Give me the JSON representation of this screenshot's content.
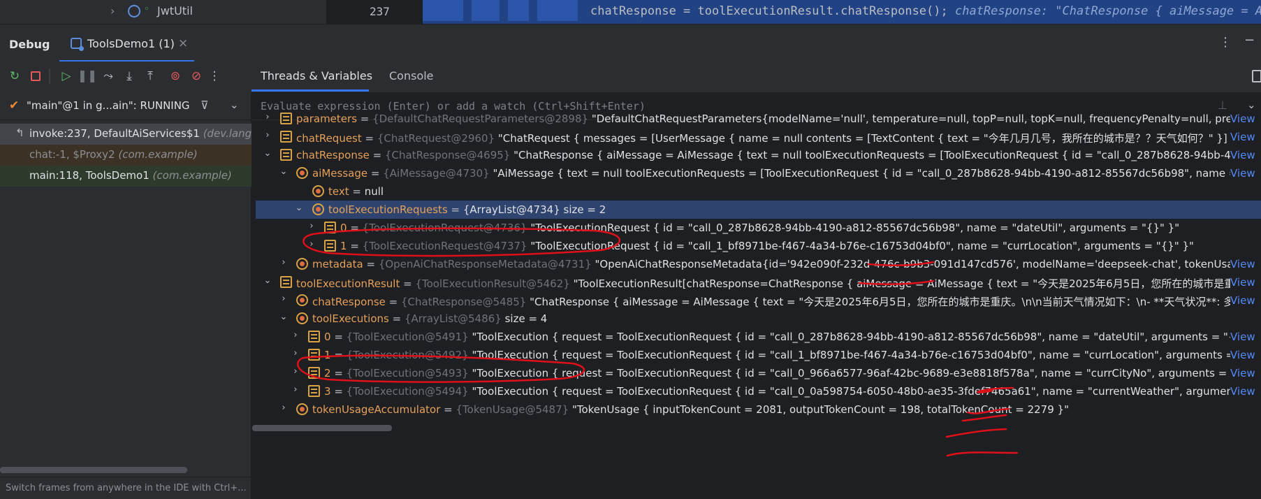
{
  "editor": {
    "tree_item": "JwtUtil",
    "line_number": "237",
    "code": "chatResponse = toolExecutionResult.chatResponse();",
    "inline_value": "chatResponse: \"ChatResponse { aiMessage = Ai"
  },
  "debug_panel": {
    "title": "Debug",
    "session_tab": "ToolsDemo1 (1)",
    "tabs": [
      "Threads & Variables",
      "Console"
    ]
  },
  "threads": {
    "selected": "\"main\"@1 in g...ain\": RUNNING",
    "frames": [
      {
        "method": "invoke:237, DefaultAiServices$1",
        "package": "(dev.langch"
      },
      {
        "method": "chat:-1, $Proxy2",
        "package": "(com.example)"
      },
      {
        "method": "main:118, ToolsDemo1",
        "package": "(com.example)"
      }
    ],
    "hint": "Switch frames from anywhere in the IDE with Ctrl+..."
  },
  "evaluate": {
    "placeholder": "Evaluate expression (Enter) or add a watch (Ctrl+Shift+Enter)"
  },
  "view_link": "View",
  "variables": [
    {
      "name": "parameters",
      "type": "{DefaultChatRequestParameters@2898}",
      "value": "\"DefaultChatRequestParameters{modelName='null', temperature=null, topP=null, topK=null, frequencyPenalty=null, presencePe"
    },
    {
      "name": "chatRequest",
      "type": "{ChatRequest@2960}",
      "value": "\"ChatRequest { messages = [UserMessage { name = null contents = [TextContent { text = \"今年几月几号，我所在的城市是？？天气如何？\" }] }], parame"
    },
    {
      "name": "chatResponse",
      "type": "{ChatResponse@4695}",
      "value": "\"ChatResponse { aiMessage = AiMessage { text = null toolExecutionRequests = [ToolExecutionRequest { id = \"call_0_287b8628-94bb-4190-a812"
    },
    {
      "name": "aiMessage",
      "type": "{AiMessage@4730}",
      "value": "\"AiMessage { text = null toolExecutionRequests = [ToolExecutionRequest { id = \"call_0_287b8628-94bb-4190-a812-85567dc56b98\", name = \"dateU"
    },
    {
      "name": "text",
      "type": "",
      "value": "null"
    },
    {
      "name": "toolExecutionRequests",
      "type": "",
      "value": "{ArrayList@4734}  size = 2"
    },
    {
      "name": "0",
      "type": "{ToolExecutionRequest@4736}",
      "value": "\"ToolExecutionRequest { id = \"call_0_287b8628-94bb-4190-a812-85567dc56b98\", name = \"dateUtil\", arguments = \"{}\" }\""
    },
    {
      "name": "1",
      "type": "{ToolExecutionRequest@4737}",
      "value": "\"ToolExecutionRequest { id = \"call_1_bf8971be-f467-4a34-b76e-c16753d04bf0\", name = \"currLocation\", arguments = \"{}\" }\""
    },
    {
      "name": "metadata",
      "type": "{OpenAiChatResponseMetadata@4731}",
      "value": "\"OpenAiChatResponseMetadata{id='942e090f-232d-476c-b9b3-091d147cd576', modelName='deepseek-chat', tokenUsage=O"
    },
    {
      "name": "toolExecutionResult",
      "type": "{ToolExecutionResult@5462}",
      "value": "\"ToolExecutionResult[chatResponse=ChatResponse { aiMessage = AiMessage { text = \"今天是2025年6月5日，您所在的城市是重庆。\\r"
    },
    {
      "name": "chatResponse",
      "type": "{ChatResponse@5485}",
      "value": "\"ChatResponse { aiMessage = AiMessage { text = \"今天是2025年6月5日，您所在的城市是重庆。\\n\\n当前天气情况如下：\\n- **天气状况**: 多云\\n-"
    },
    {
      "name": "toolExecutions",
      "type": "{ArrayList@5486}",
      "value": "size = 4"
    },
    {
      "name": "0",
      "type": "{ToolExecution@5491}",
      "value": "\"ToolExecution { request = ToolExecutionRequest { id = \"call_0_287b8628-94bb-4190-a812-85567dc56b98\", name = \"dateUtil\", arguments = \"{}\" }, res"
    },
    {
      "name": "1",
      "type": "{ToolExecution@5492}",
      "value": "\"ToolExecution { request = ToolExecutionRequest { id = \"call_1_bf8971be-f467-4a34-b76e-c16753d04bf0\", name = \"currLocation\", arguments = \"{}\" },"
    },
    {
      "name": "2",
      "type": "{ToolExecution@5493}",
      "value": "\"ToolExecution { request = ToolExecutionRequest { id = \"call_0_966a6577-96af-42bc-9689-e3e8818f578a\", name = \"currCityNo\", arguments = \"{\"cityI"
    },
    {
      "name": "3",
      "type": "{ToolExecution@5494}",
      "value": "\"ToolExecution { request = ToolExecutionRequest { id = \"call_0_0a598754-6050-48b0-ae35-3fdef7465a61\", name = \"currentWeather\", arguments = \"{'"
    },
    {
      "name": "tokenUsageAccumulator",
      "type": "{TokenUsage@5487}",
      "value": "\"TokenUsage { inputTokenCount = 2081, outputTokenCount = 198, totalTokenCount = 2279 }\""
    }
  ],
  "colors": {
    "accent": "#3574f0",
    "selection": "#2e436e",
    "field_name": "#e5a05a",
    "annotation": "#e0101a"
  }
}
